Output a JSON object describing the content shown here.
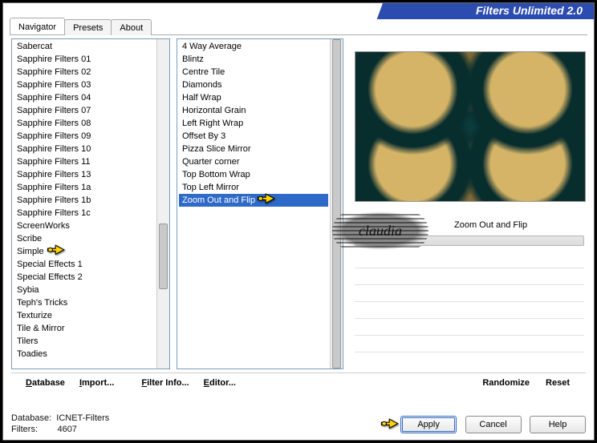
{
  "header": {
    "title": "Filters Unlimited 2.0"
  },
  "tabs": [
    {
      "label": "Navigator",
      "active": true
    },
    {
      "label": "Presets",
      "active": false
    },
    {
      "label": "About",
      "active": false
    }
  ],
  "left_list": {
    "items": [
      "Sabercat",
      "Sapphire Filters 01",
      "Sapphire Filters 02",
      "Sapphire Filters 03",
      "Sapphire Filters 04",
      "Sapphire Filters 07",
      "Sapphire Filters 08",
      "Sapphire Filters 09",
      "Sapphire Filters 10",
      "Sapphire Filters 11",
      "Sapphire Filters 13",
      "Sapphire Filters 1a",
      "Sapphire Filters 1b",
      "Sapphire Filters 1c",
      "ScreenWorks",
      "Scribe",
      "Simple",
      "Special Effects 1",
      "Special Effects 2",
      "Sybia",
      "Teph's Tricks",
      "Texturize",
      "Tile & Mirror",
      "Tilers",
      "Toadies"
    ],
    "selected_index": -1,
    "pointer_index": 16,
    "thumb": {
      "top_pct": 56,
      "height_pct": 20
    }
  },
  "mid_list": {
    "items": [
      "4 Way Average",
      "Blintz",
      "Centre Tile",
      "Diamonds",
      "Half Wrap",
      "Horizontal Grain",
      "Left Right Wrap",
      "Offset By 3",
      "Pizza Slice Mirror",
      "Quarter corner",
      "Top Bottom Wrap",
      "Top Left Mirror",
      "Zoom Out and Flip"
    ],
    "selected_index": 12,
    "pointer_index": 12,
    "thumb": {
      "top_pct": 0,
      "height_pct": 100
    }
  },
  "preview": {
    "selected_filter_name": "Zoom Out and Flip"
  },
  "badge_text": "claudia",
  "bottom_links": {
    "left": [
      "Database",
      "Import...",
      "Filter Info...",
      "Editor..."
    ],
    "right": [
      "Randomize",
      "Reset"
    ]
  },
  "status": {
    "database_label": "Database:",
    "database_value": "ICNET-Filters",
    "filters_label": "Filters:",
    "filters_value": "4607"
  },
  "buttons": {
    "apply": "Apply",
    "cancel": "Cancel",
    "help": "Help"
  },
  "sep_line_tops": [
    290,
    311,
    332,
    353,
    374,
    395
  ]
}
